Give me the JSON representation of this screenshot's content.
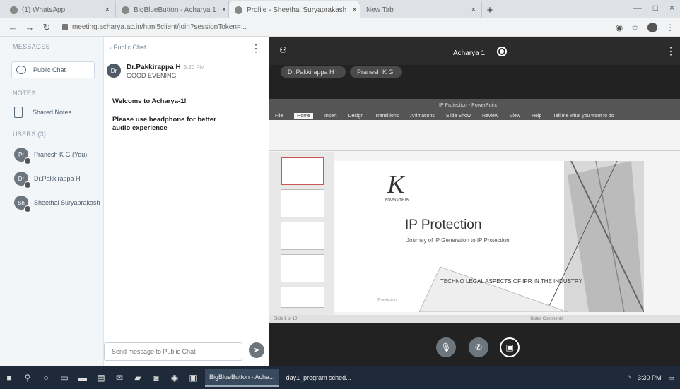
{
  "browser": {
    "tabs": [
      {
        "label": "(1) WhatsApp",
        "close": "×"
      },
      {
        "label": "BigBlueButton - Acharya 1",
        "close": "×"
      },
      {
        "label": "Profile - Sheethal Suryaprakash",
        "close": "×"
      },
      {
        "label": "New Tab",
        "close": "×"
      }
    ],
    "new_tab": "+",
    "url": "meeting.acharya.ac.in/html5client/join?sessionToken=...",
    "window_controls": [
      "—",
      "□",
      "×"
    ]
  },
  "userlist": {
    "messages_title": "MESSAGES",
    "public_chat": "Public Chat",
    "notes_title": "NOTES",
    "shared_notes": "Shared Notes",
    "users_title": "USERS (3)",
    "users": [
      {
        "initials": "Pr",
        "name": "Pranesh K G (You)"
      },
      {
        "initials": "Dr",
        "name": "Dr.Pakkirappa H"
      },
      {
        "initials": "Sh",
        "name": "Sheethal Suryaprakash"
      }
    ]
  },
  "chat": {
    "header": "‹ Public Chat",
    "kebab": "⋮",
    "message": {
      "initials": "Dr",
      "name": "Dr.Pakkirappa H",
      "time": "5:20 PM",
      "text": "GOOD EVENING"
    },
    "welcome": "Welcome to Acharya-1!",
    "headphone": "Please use headphone for better audio experience",
    "input_placeholder": "Send message to Public Chat",
    "send": "➤"
  },
  "stage": {
    "title": "Acharya 1",
    "kebab": "⋮",
    "pills": [
      "Dr.Pakkirappa H",
      "Pranesh K G"
    ],
    "ppt": {
      "app_title": "IP Protection - PowerPoint",
      "menus": [
        "File",
        "Home",
        "Insert",
        "Design",
        "Transitions",
        "Animations",
        "Slide Show",
        "Review",
        "View",
        "Help",
        "Tell me what you want to do"
      ],
      "active_menu": "Home",
      "status_left": "Slide 1 of 10",
      "status_right": "Notes  Comments"
    },
    "slide": {
      "logo": "K",
      "logo_sub": "KNOWSHIFTA",
      "title": "IP Protection",
      "subtitle": "Journey of IP Generation to IP Protection",
      "footer": "TECHNO LEGAL ASPECTS OF IPR IN THE INDUSTRY",
      "tiny": "IP protection"
    },
    "controls": {
      "mic": "🎙",
      "phone": "✆",
      "video": "▣"
    }
  },
  "taskbar": {
    "apps": [
      {
        "label": "BigBlueButton - Acha...",
        "active": true
      },
      {
        "label": "day1_program sched...",
        "active": false
      }
    ],
    "time": "3:30 PM",
    "tray": "^"
  },
  "colors": {
    "accent_blue": "#0f70d7",
    "stage_bg": "#222222",
    "taskbar": "#1e2a3a"
  }
}
